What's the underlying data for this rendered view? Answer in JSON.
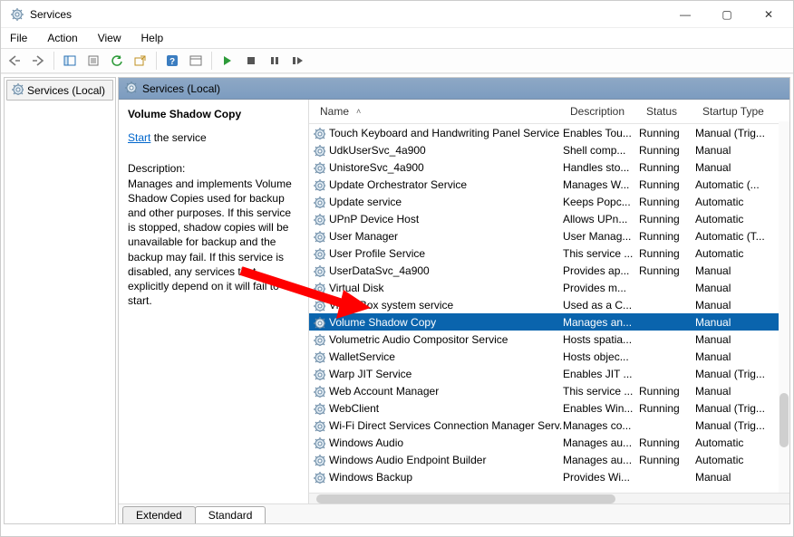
{
  "window": {
    "title": "Services",
    "controls": {
      "minimize": "—",
      "maximize": "▢",
      "close": "✕"
    }
  },
  "menu": {
    "items": [
      "File",
      "Action",
      "View",
      "Help"
    ]
  },
  "nav": {
    "root": "Services (Local)"
  },
  "rightHeader": "Services (Local)",
  "details": {
    "title": "Volume Shadow Copy",
    "start_link": "Start",
    "start_suffix": "the service",
    "desc_label": "Description:",
    "description": "Manages and implements Volume Shadow Copies used for backup and other purposes. If this service is stopped, shadow copies will be unavailable for backup and the backup may fail. If this service is disabled, any services that explicitly depend on it will fail to start."
  },
  "columns": {
    "name": "Name",
    "description": "Description",
    "status": "Status",
    "startup": "Startup Type"
  },
  "tabs": {
    "extended": "Extended",
    "standard": "Standard"
  },
  "rows": [
    {
      "name": "Touch Keyboard and Handwriting Panel Service",
      "desc": "Enables Tou...",
      "status": "Running",
      "startup": "Manual (Trig..."
    },
    {
      "name": "UdkUserSvc_4a900",
      "desc": "Shell comp...",
      "status": "Running",
      "startup": "Manual"
    },
    {
      "name": "UnistoreSvc_4a900",
      "desc": "Handles sto...",
      "status": "Running",
      "startup": "Manual"
    },
    {
      "name": "Update Orchestrator Service",
      "desc": "Manages W...",
      "status": "Running",
      "startup": "Automatic (..."
    },
    {
      "name": "Update service",
      "desc": "Keeps Popc...",
      "status": "Running",
      "startup": "Automatic"
    },
    {
      "name": "UPnP Device Host",
      "desc": "Allows UPn...",
      "status": "Running",
      "startup": "Automatic"
    },
    {
      "name": "User Manager",
      "desc": "User Manag...",
      "status": "Running",
      "startup": "Automatic (T..."
    },
    {
      "name": "User Profile Service",
      "desc": "This service ...",
      "status": "Running",
      "startup": "Automatic"
    },
    {
      "name": "UserDataSvc_4a900",
      "desc": "Provides ap...",
      "status": "Running",
      "startup": "Manual"
    },
    {
      "name": "Virtual Disk",
      "desc": "Provides m...",
      "status": "",
      "startup": "Manual"
    },
    {
      "name": "VirtualBox system service",
      "desc": "Used as a C...",
      "status": "",
      "startup": "Manual"
    },
    {
      "name": "Volume Shadow Copy",
      "desc": "Manages an...",
      "status": "",
      "startup": "Manual",
      "selected": true
    },
    {
      "name": "Volumetric Audio Compositor Service",
      "desc": "Hosts spatia...",
      "status": "",
      "startup": "Manual"
    },
    {
      "name": "WalletService",
      "desc": "Hosts objec...",
      "status": "",
      "startup": "Manual"
    },
    {
      "name": "Warp JIT Service",
      "desc": "Enables JIT ...",
      "status": "",
      "startup": "Manual (Trig..."
    },
    {
      "name": "Web Account Manager",
      "desc": "This service ...",
      "status": "Running",
      "startup": "Manual"
    },
    {
      "name": "WebClient",
      "desc": "Enables Win...",
      "status": "Running",
      "startup": "Manual (Trig..."
    },
    {
      "name": "Wi-Fi Direct Services Connection Manager Serv...",
      "desc": "Manages co...",
      "status": "",
      "startup": "Manual (Trig..."
    },
    {
      "name": "Windows Audio",
      "desc": "Manages au...",
      "status": "Running",
      "startup": "Automatic"
    },
    {
      "name": "Windows Audio Endpoint Builder",
      "desc": "Manages au...",
      "status": "Running",
      "startup": "Automatic"
    },
    {
      "name": "Windows Backup",
      "desc": "Provides Wi...",
      "status": "",
      "startup": "Manual"
    }
  ]
}
